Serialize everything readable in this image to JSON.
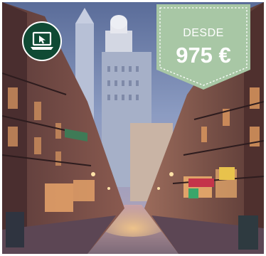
{
  "offer": {
    "price_label": "DESDE",
    "price_value": "975 €"
  },
  "badge": {
    "icon": "laptop-cursor-icon",
    "color": "#0f4a34"
  },
  "colors": {
    "tag": "#a9c8a6",
    "sky": "#7d8fb8",
    "street_glow": "#e8a86b"
  }
}
